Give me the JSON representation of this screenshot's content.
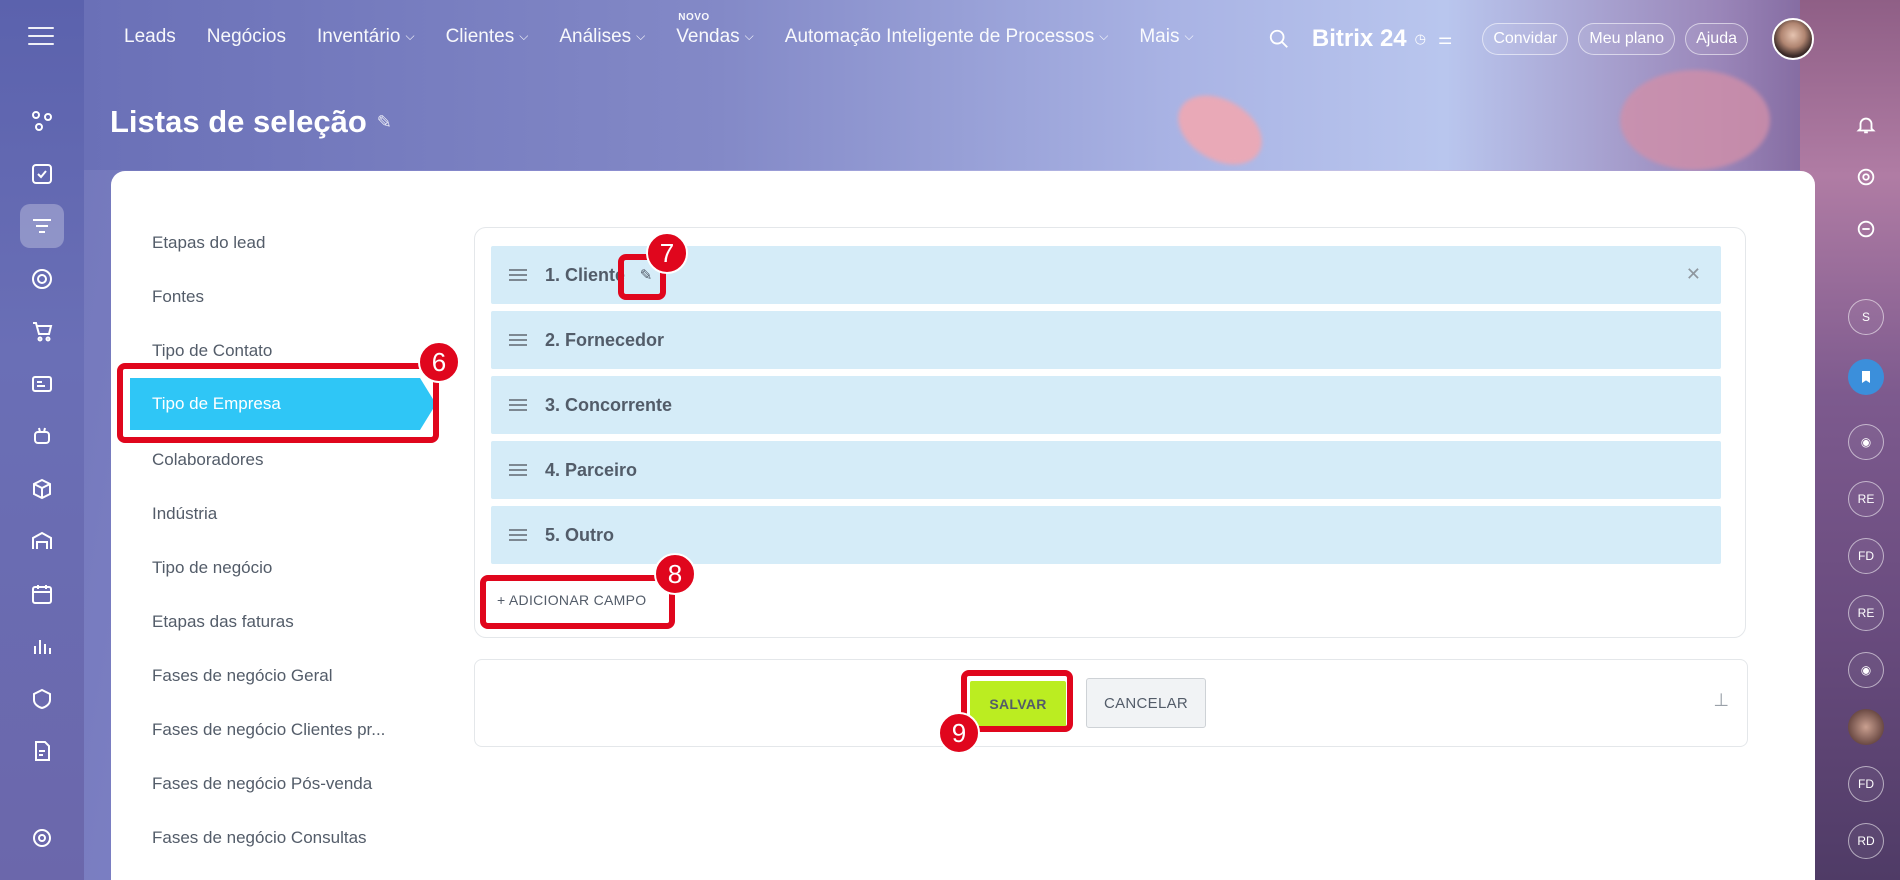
{
  "topnav": {
    "items": [
      {
        "label": "Leads",
        "chevron": false
      },
      {
        "label": "Negócios",
        "chevron": false
      },
      {
        "label": "Inventário",
        "chevron": true
      },
      {
        "label": "Clientes",
        "chevron": true
      },
      {
        "label": "Análises",
        "chevron": true
      },
      {
        "label": "Vendas",
        "chevron": true,
        "badge": "NOVO"
      },
      {
        "label": "Automação Inteligente de Processos",
        "chevron": true
      },
      {
        "label": "Mais",
        "chevron": true
      }
    ],
    "brand": "Bitrix 24",
    "invite": "Convidar",
    "plan": "Meu plano",
    "help": "Ajuda"
  },
  "page": {
    "title": "Listas de seleção"
  },
  "sidebar": {
    "items": [
      "Etapas do lead",
      "Fontes",
      "Tipo de Contato",
      "Tipo de Empresa",
      "Colaboradores",
      "Indústria",
      "Tipo de negócio",
      "Etapas das faturas",
      "Fases de negócio Geral",
      "Fases de negócio Clientes pr...",
      "Fases de negócio Pós-venda",
      "Fases de negócio Consultas"
    ],
    "active_index": 3
  },
  "fields": [
    "1. Cliente",
    "2. Fornecedor",
    "3. Concorrente",
    "4. Parceiro",
    "5. Outro"
  ],
  "add_field": "+ ADICIONAR CAMPO",
  "buttons": {
    "save": "SALVAR",
    "cancel": "CANCELAR"
  },
  "rightrail": {
    "initials": [
      "S",
      "RE",
      "FD",
      "RE",
      "FD",
      "RD"
    ]
  },
  "callouts": [
    "6",
    "7",
    "8",
    "9"
  ],
  "colors": {
    "accent": "#2fc6f6",
    "save": "#bbed21",
    "highlight": "#e0061d",
    "field_bg": "#d5ecf8"
  }
}
